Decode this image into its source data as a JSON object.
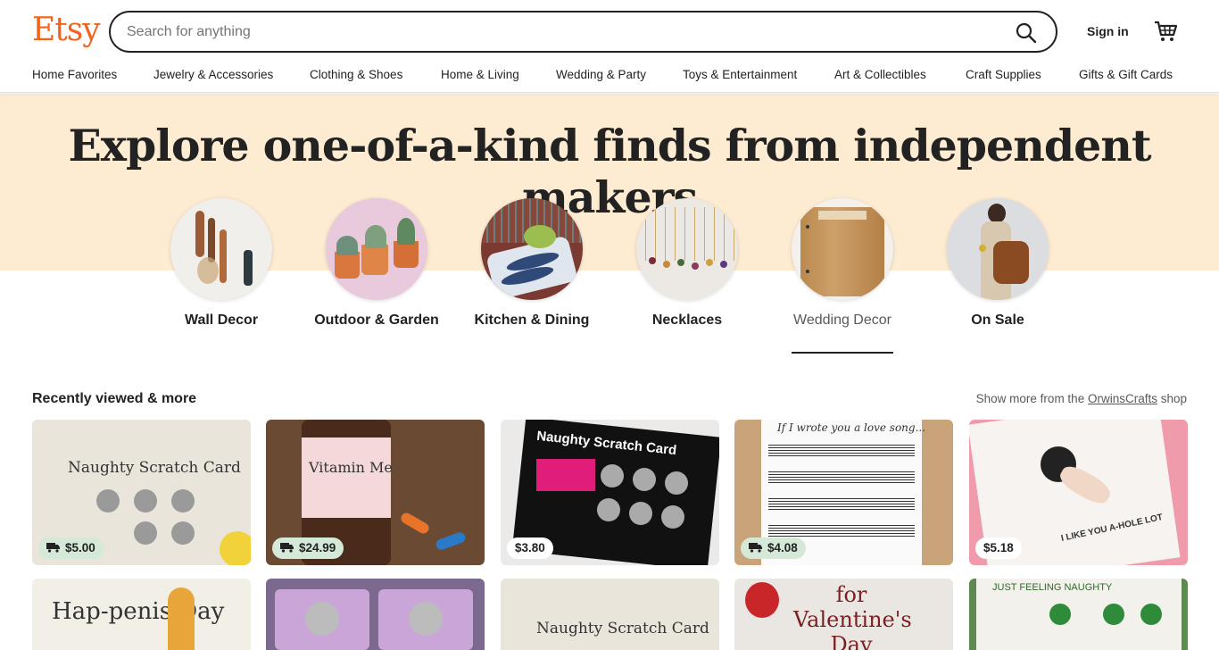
{
  "header": {
    "logo": "Etsy",
    "search_placeholder": "Search for anything",
    "search_icon": "search-icon",
    "signin_label": "Sign in",
    "cart_icon": "cart-icon"
  },
  "nav": {
    "items": [
      "Home Favorites",
      "Jewelry & Accessories",
      "Clothing & Shoes",
      "Home & Living",
      "Wedding & Party",
      "Toys & Entertainment",
      "Art & Collectibles",
      "Craft Supplies",
      "Gifts & Gift Cards"
    ]
  },
  "hero": {
    "title": "Explore one-of-a-kind finds from independent makers",
    "categories": [
      {
        "label": "Wall Decor"
      },
      {
        "label": "Outdoor & Garden"
      },
      {
        "label": "Kitchen & Dining"
      },
      {
        "label": "Necklaces"
      },
      {
        "label": "Wedding Decor",
        "active": true
      },
      {
        "label": "On Sale"
      }
    ]
  },
  "recently_viewed": {
    "title": "Recently viewed & more",
    "more_prefix": "Show more from the ",
    "shop_name": "OrwinsCrafts",
    "more_suffix": " shop",
    "items": [
      {
        "price": "$5.00",
        "free_shipping": true,
        "text": "Naughty Scratch Card"
      },
      {
        "price": "$24.99",
        "free_shipping": true,
        "text": "Vitamin Me"
      },
      {
        "price": "$3.80",
        "free_shipping": false,
        "text": "Naughty Scratch Card"
      },
      {
        "price": "$4.08",
        "free_shipping": true,
        "text": "If I wrote you a love song..."
      },
      {
        "price": "$5.18",
        "free_shipping": false,
        "text": "I LIKE YOU A-HOLE LOT"
      }
    ],
    "row2_items": [
      {
        "text": "Hap-penis Day"
      },
      {
        "text": ""
      },
      {
        "text": "Naughty Scratch Card"
      },
      {
        "text": "for Valentine's Day"
      },
      {
        "text": "JUST FEELING NAUGHTY"
      }
    ]
  },
  "colors": {
    "brand": "#f1641e",
    "hero_bg": "#fdebd2",
    "ship_badge": "#d4e9d7"
  }
}
